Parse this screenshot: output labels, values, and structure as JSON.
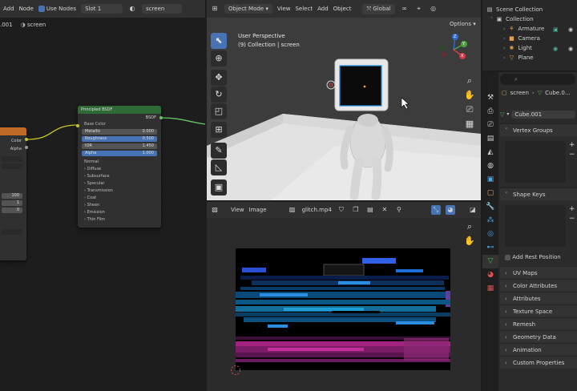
{
  "node_editor": {
    "header": {
      "menu_add": "Add",
      "menu_node": "Node",
      "use_nodes_label": "Use Nodes",
      "slot": "Slot 1",
      "material_name": "screen",
      "breadcrumb_left": ".001",
      "breadcrumb_material": "screen"
    },
    "image_node": {
      "out_color": "Color",
      "out_alpha": "Alpha",
      "values": [
        "100",
        "1",
        "0"
      ]
    },
    "bsdf_node": {
      "title": "Principled BSDF",
      "output": "BSDF",
      "base_color": "Base Color",
      "rows": [
        {
          "label": "Metallic",
          "value": "0.000",
          "style": "grey"
        },
        {
          "label": "Roughness",
          "value": "0.500",
          "style": "blue"
        },
        {
          "label": "IOR",
          "value": "1.450",
          "style": "grey"
        },
        {
          "label": "Alpha",
          "value": "1.000",
          "style": "blue"
        }
      ],
      "normal": "Normal",
      "subpanels": [
        "Diffuse",
        "Subsurface",
        "Specular",
        "Transmission",
        "Coat",
        "Sheen",
        "Emission",
        "Thin Film"
      ]
    }
  },
  "viewport": {
    "header": {
      "mode": "Object Mode",
      "menus": [
        "View",
        "Select",
        "Add",
        "Object"
      ],
      "orientation": "Global",
      "options": "Options"
    },
    "overlay_title": "User Perspective",
    "overlay_collection": "(9) Collection | screen",
    "gizmo_axes": [
      "Z",
      "Y",
      "X"
    ]
  },
  "image_editor": {
    "header": {
      "menus": [
        "View",
        "Image"
      ],
      "image_name": "glitch.mp4"
    }
  },
  "outliner": {
    "title": "Scene Collection",
    "items": [
      {
        "label": "Collection",
        "indent": 1
      },
      {
        "label": "Armature",
        "indent": 2
      },
      {
        "label": "Camera",
        "indent": 2
      },
      {
        "label": "Light",
        "indent": 2
      },
      {
        "label": "Plane",
        "indent": 2
      }
    ]
  },
  "properties": {
    "breadcrumb_object": "screen",
    "breadcrumb_data": "Cube.0...",
    "mesh_name": "Cube.001",
    "panels_open": [
      "Vertex Groups",
      "Shape Keys"
    ],
    "add_rest_position": "Add Rest Position",
    "panels_closed": [
      "UV Maps",
      "Color Attributes",
      "Attributes",
      "Texture Space",
      "Remesh",
      "Geometry Data",
      "Animation",
      "Custom Properties"
    ]
  },
  "colors": {
    "accent": "#4772b3",
    "node_header_green": "#2d6a36",
    "image_node_orange": "#c06a27",
    "link_yellow": "#c7c729",
    "link_green": "#63c763"
  }
}
